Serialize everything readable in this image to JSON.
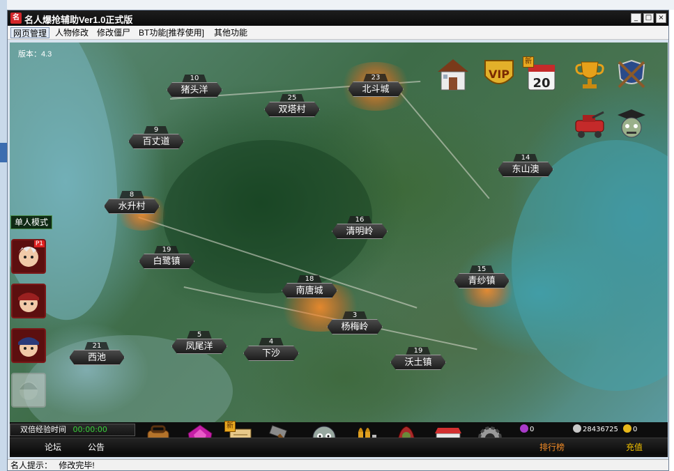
{
  "window": {
    "title": "名人爆抢辅助Ver1.0正式版",
    "app_icon_glyph": "名",
    "minimize": "_",
    "maximize": "□",
    "close": "×"
  },
  "menu": {
    "items": [
      {
        "label": "网页管理"
      },
      {
        "label": "人物修改"
      },
      {
        "label": "修改僵尸"
      },
      {
        "label": "BT功能[推荐使用]"
      },
      {
        "label": "其他功能"
      }
    ]
  },
  "game": {
    "version": "版本：4.3",
    "mode_tab": "单人模式",
    "p1_badge": "P1",
    "locations": [
      {
        "num": "10",
        "name": "猪头洋"
      },
      {
        "num": "25",
        "name": "双塔村"
      },
      {
        "num": "23",
        "name": "北斗城"
      },
      {
        "num": "9",
        "name": "百丈道"
      },
      {
        "num": "14",
        "name": "东山澳"
      },
      {
        "num": "8",
        "name": "水升村"
      },
      {
        "num": "16",
        "name": "清明岭"
      },
      {
        "num": "19",
        "name": "白鹭镇"
      },
      {
        "num": "15",
        "name": "青纱镇"
      },
      {
        "num": "18",
        "name": "南唐城"
      },
      {
        "num": "3",
        "name": "杨梅岭"
      },
      {
        "num": "5",
        "name": "凤尾洋"
      },
      {
        "num": "4",
        "name": "下沙"
      },
      {
        "num": "21",
        "name": "西池"
      },
      {
        "num": "19",
        "name": "沃土镇"
      }
    ],
    "top_icons": [
      {
        "name": "house-icon"
      },
      {
        "name": "vip-icon",
        "label": "VIP"
      },
      {
        "name": "calendar-icon",
        "label": "20",
        "badge": "新"
      },
      {
        "name": "trophy-icon"
      },
      {
        "name": "crossed-guns-icon"
      },
      {
        "name": "tank-icon"
      },
      {
        "name": "zombie-graduate-icon"
      }
    ]
  },
  "bottom": {
    "double_exp_label": "双倍经验时间",
    "double_exp_time": "00:00:00",
    "tools": [
      {
        "name": "backpack-icon"
      },
      {
        "name": "gem-icon"
      },
      {
        "name": "scroll-icon",
        "badge": "新"
      },
      {
        "name": "hammer-icon"
      },
      {
        "name": "zombie-head-icon"
      },
      {
        "name": "bullets-icon"
      },
      {
        "name": "hooded-figure-icon"
      },
      {
        "name": "shop-icon"
      },
      {
        "name": "gear-icon"
      }
    ],
    "points_label": "0",
    "silver": "28436725",
    "gold": "0",
    "forum": "论坛",
    "notice": "公告",
    "ranking": "排行榜",
    "recharge": "充值"
  },
  "status": {
    "label": "名人提示：",
    "message": "修改完毕!"
  },
  "colors": {
    "title_bar": "#111111",
    "accent_orange": "#f08a26",
    "recharge_text": "#f5c400",
    "exp_time_color": "#39d13a"
  }
}
